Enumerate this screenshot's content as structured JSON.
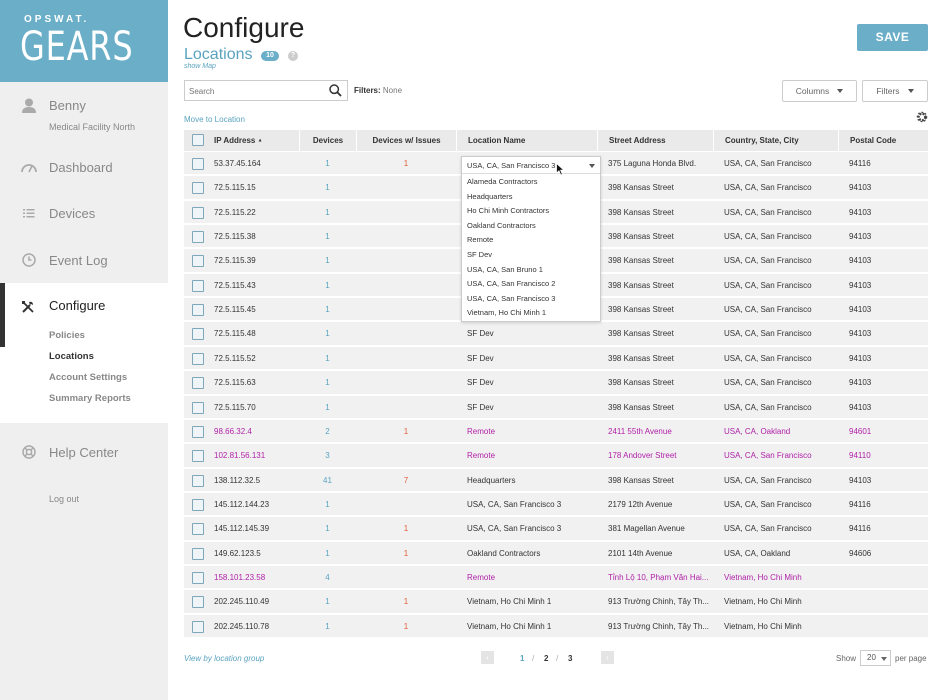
{
  "sidebar": {
    "brand_small": "OPSWAT.",
    "brand_large": "GEARS",
    "user_name": "Benny",
    "user_org": "Medical Facility North",
    "nav": {
      "dashboard": "Dashboard",
      "devices": "Devices",
      "event_log": "Event Log",
      "configure": "Configure",
      "help_center": "Help Center"
    },
    "configure_sub": {
      "policies": "Policies",
      "locations": "Locations",
      "account_settings": "Account Settings",
      "summary_reports": "Summary Reports"
    },
    "logout": "Log out"
  },
  "header": {
    "title": "Configure",
    "subtitle": "Locations",
    "count": "10",
    "help": "?",
    "show_map": "show Map",
    "save_label": "SAVE"
  },
  "toolbar": {
    "search_placeholder": "Search",
    "filters_label": "Filters:",
    "filters_value": "None",
    "columns_label": "Columns",
    "filters_button": "Filters",
    "move_to_location": "Move to Location"
  },
  "table": {
    "headers": {
      "ip": "IP Address",
      "sort_indicator": "▲",
      "devices": "Devices",
      "issues": "Devices w/ Issues",
      "location": "Location Name",
      "street": "Street Address",
      "region": "Country, State, City",
      "postal": "Postal Code"
    },
    "rows": [
      {
        "ip": "53.37.45.164",
        "devices": "1",
        "issues": "1",
        "location": "",
        "street": "375 Laguna Honda Blvd.",
        "region": "USA, CA, San Francisco",
        "postal": "94116"
      },
      {
        "ip": "72.5.115.15",
        "devices": "1",
        "issues": "",
        "location": "",
        "street": "398 Kansas Street",
        "region": "USA, CA, San Francisco",
        "postal": "94103"
      },
      {
        "ip": "72.5.115.22",
        "devices": "1",
        "issues": "",
        "location": "",
        "street": "398 Kansas Street",
        "region": "USA, CA, San Francisco",
        "postal": "94103"
      },
      {
        "ip": "72.5.115.38",
        "devices": "1",
        "issues": "",
        "location": "",
        "street": "398 Kansas Street",
        "region": "USA, CA, San Francisco",
        "postal": "94103"
      },
      {
        "ip": "72.5.115.39",
        "devices": "1",
        "issues": "",
        "location": "",
        "street": "398 Kansas Street",
        "region": "USA, CA, San Francisco",
        "postal": "94103"
      },
      {
        "ip": "72.5.115.43",
        "devices": "1",
        "issues": "",
        "location": "",
        "street": "398 Kansas Street",
        "region": "USA, CA, San Francisco",
        "postal": "94103"
      },
      {
        "ip": "72.5.115.45",
        "devices": "1",
        "issues": "",
        "location": "",
        "street": "398 Kansas Street",
        "region": "USA, CA, San Francisco",
        "postal": "94103"
      },
      {
        "ip": "72.5.115.48",
        "devices": "1",
        "issues": "",
        "location": "SF Dev",
        "street": "398 Kansas Street",
        "region": "USA, CA, San Francisco",
        "postal": "94103"
      },
      {
        "ip": "72.5.115.52",
        "devices": "1",
        "issues": "",
        "location": "SF Dev",
        "street": "398 Kansas Street",
        "region": "USA, CA, San Francisco",
        "postal": "94103"
      },
      {
        "ip": "72.5.115.63",
        "devices": "1",
        "issues": "",
        "location": "SF Dev",
        "street": "398 Kansas Street",
        "region": "USA, CA, San Francisco",
        "postal": "94103"
      },
      {
        "ip": "72.5.115.70",
        "devices": "1",
        "issues": "",
        "location": "SF Dev",
        "street": "398 Kansas Street",
        "region": "USA, CA, San Francisco",
        "postal": "94103"
      },
      {
        "ip": "98.66.32.4",
        "devices": "2",
        "issues": "1",
        "location": "Remote",
        "street": "2411 55th Avenue",
        "region": "USA, CA, Oakland",
        "postal": "94601",
        "highlight": true
      },
      {
        "ip": "102.81.56.131",
        "devices": "3",
        "issues": "",
        "location": "Remote",
        "street": "178 Andover Street",
        "region": "USA, CA, San Francisco",
        "postal": "94110",
        "highlight": true
      },
      {
        "ip": "138.112.32.5",
        "devices": "41",
        "issues": "7",
        "location": "Headquarters",
        "street": "398 Kansas Street",
        "region": "USA, CA, San Francisco",
        "postal": "94103"
      },
      {
        "ip": "145.112.144.23",
        "devices": "1",
        "issues": "",
        "location": "USA, CA, San Francisco 3",
        "street": "2179 12th Avenue",
        "region": "USA, CA, San Francisco",
        "postal": "94116"
      },
      {
        "ip": "145.112.145.39",
        "devices": "1",
        "issues": "1",
        "location": "USA, CA, San Francisco 3",
        "street": "381 Magellan Avenue",
        "region": "USA, CA, San Francisco",
        "postal": "94116"
      },
      {
        "ip": "149.62.123.5",
        "devices": "1",
        "issues": "1",
        "location": "Oakland Contractors",
        "street": "2101 14th Avenue",
        "region": "USA, CA, Oakland",
        "postal": "94606"
      },
      {
        "ip": "158.101.23.58",
        "devices": "4",
        "issues": "",
        "location": "Remote",
        "street": "Tỉnh Lộ 10, Phạm Văn Hai...",
        "region": "Vietnam, Ho Chi Minh",
        "postal": "",
        "highlight": true
      },
      {
        "ip": "202.245.110.49",
        "devices": "1",
        "issues": "1",
        "location": "Vietnam, Ho Chi Minh 1",
        "street": "913 Trường Chinh, Tây Th...",
        "region": "Vietnam, Ho Chi Minh",
        "postal": ""
      },
      {
        "ip": "202.245.110.78",
        "devices": "1",
        "issues": "1",
        "location": "Vietnam, Ho Chi Minh 1",
        "street": "913 Trường Chinh, Tây Th...",
        "region": "Vietnam, Ho Chi Minh",
        "postal": ""
      }
    ]
  },
  "location_dropdown": {
    "selected": "USA, CA, San Francisco 3",
    "options": [
      "Alameda Contractors",
      "Headquarters",
      "Ho Chi Minh Contractors",
      "Oakland Contractors",
      "Remote",
      "SF Dev",
      "USA, CA, San Bruno 1",
      "USA, CA, San Francisco 2",
      "USA, CA, San Francisco 3",
      "Vietnam, Ho Chi Minh 1"
    ]
  },
  "footer": {
    "view_by_group": "View by location group",
    "prev": "‹",
    "next": "›",
    "pages": [
      "1",
      "2",
      "3"
    ],
    "separator": "/",
    "current_page": "1",
    "show_label": "Show",
    "per_page_value": "20",
    "per_page_label": "per page"
  },
  "colors": {
    "accent": "#6aaec8",
    "link": "#5aa3bf",
    "issues": "#e05e3a",
    "highlight": "#b021a8"
  }
}
